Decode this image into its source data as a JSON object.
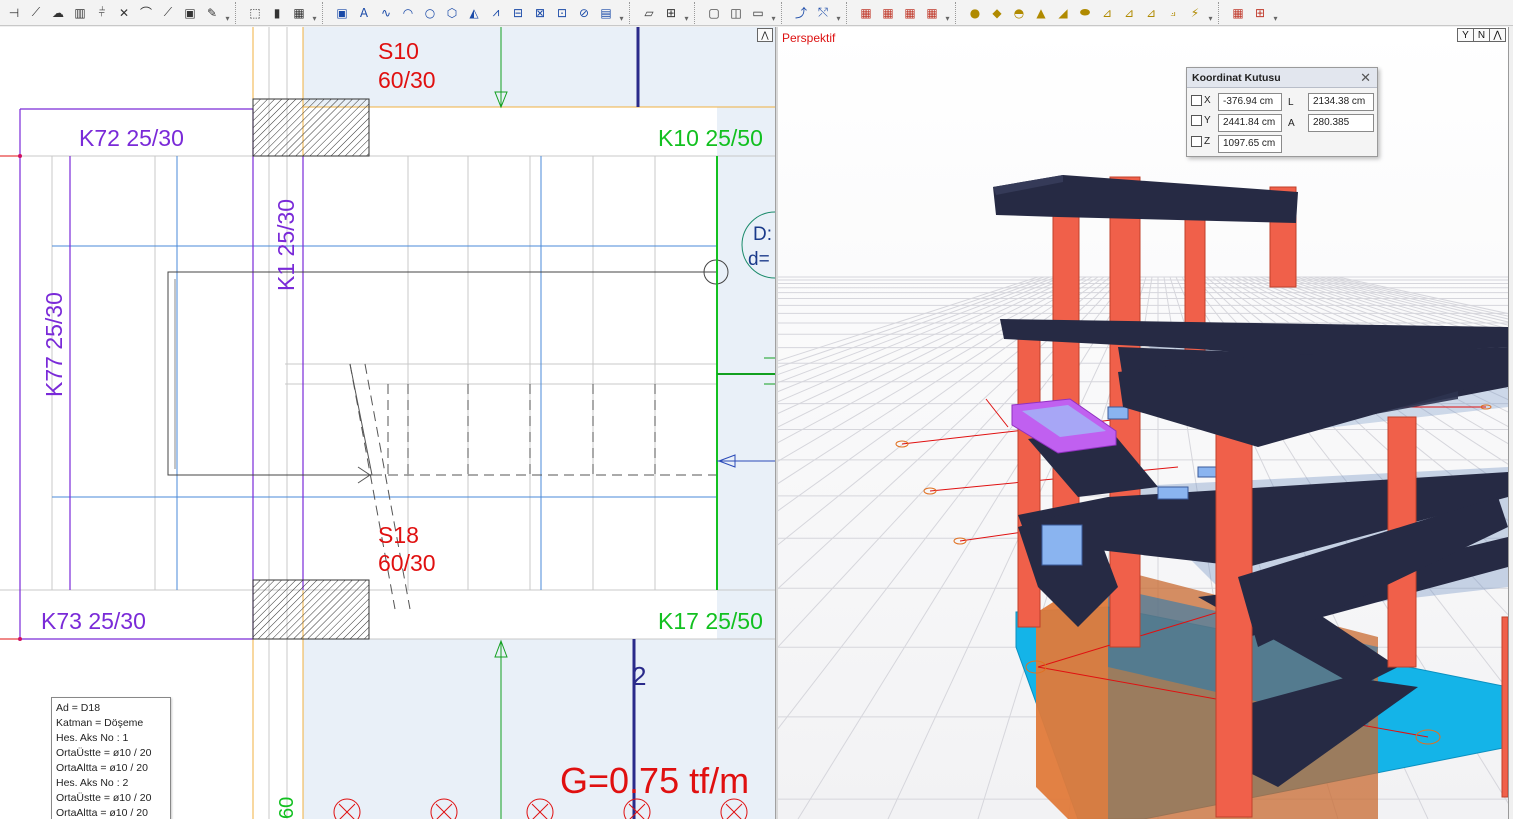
{
  "toolbar": {
    "groups": [
      [
        "⊣",
        "⟋",
        "☁",
        "▥",
        "⫩",
        "✕",
        "⌒",
        "⟋",
        "▣",
        "✎"
      ],
      [
        "⬚",
        "▮",
        "▦"
      ],
      [
        "▣",
        "A",
        "∿",
        "◠",
        "○",
        "⬡",
        "◭",
        "⩘",
        "⊟",
        "⊠",
        "⊡",
        "⊘",
        "▤"
      ],
      [
        "⏥",
        "⊞"
      ],
      [
        "▢",
        "◫",
        "▭"
      ],
      [
        "⤴",
        "⤲"
      ],
      [
        "▦",
        "▦",
        "▦",
        "▦"
      ],
      [
        "●",
        "◆",
        "◓",
        "▲",
        "◢",
        "⬬",
        "⊿",
        "⊿",
        "⊿",
        "⟓",
        "⚡"
      ],
      [
        "▦",
        "⊞"
      ]
    ]
  },
  "left_view": {
    "scroll_up_label": "⋀",
    "labels": {
      "s10_name": "S10",
      "s10_size": "60/30",
      "s18_name": "S18",
      "s18_size": "60/30",
      "k72": "K72 25/30",
      "k73": "K73 25/30",
      "k10": "K10 25/50",
      "k17": "K17 25/50",
      "k77": "K77 25/30",
      "k1": "K1 25/30",
      "axis_2": "2",
      "load": "G=0.75 tf/m",
      "slab_name_partial": "D:",
      "slab_d_partial": "d=",
      "bottom_partial": "60"
    },
    "properties": [
      "Ad = D18",
      "Katman = Döşeme",
      "Hes. Aks No : 1",
      "OrtaÜstte = ø10 / 20",
      "OrtaAltta = ø10 / 20",
      "Hes. Aks No : 2",
      "OrtaÜstte = ø10 / 20",
      "OrtaAltta = ø10 / 20"
    ]
  },
  "right_view": {
    "title": "Perspektif",
    "view_buttons": [
      "Y",
      "N",
      "⋀"
    ],
    "coord_box": {
      "title": "Koordinat Kutusu",
      "close": "✕",
      "x_label": "X",
      "y_label": "Y",
      "z_label": "Z",
      "x_value": "-376.94 cm",
      "y_value": "2441.84 cm",
      "z_value": "1097.65 cm",
      "l_label": "L",
      "a_label": "A",
      "l_value": "2134.38 cm",
      "a_value": "280.385"
    }
  },
  "colors": {
    "column": "#f0604a",
    "beam": "#262a44",
    "foundation": "#14b4e8",
    "selected_slab": "#c060f0",
    "plan_purple": "#7a2ad8",
    "plan_red": "#e01010",
    "plan_green": "#12c020",
    "plan_blue": "#2a2a8a"
  }
}
